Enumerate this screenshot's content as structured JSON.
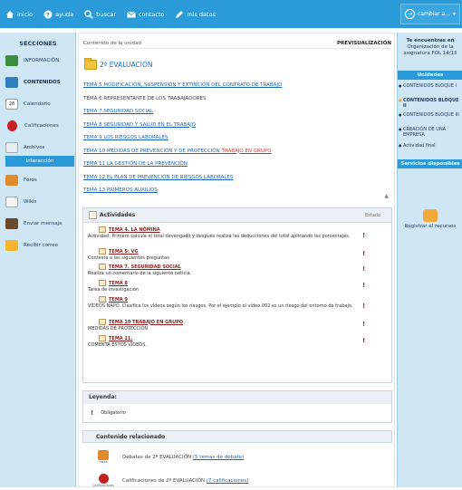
{
  "nav": {
    "items": [
      {
        "label": "inicio",
        "icon": "home-icon"
      },
      {
        "label": "ayuda",
        "icon": "help-icon"
      },
      {
        "label": "buscar",
        "icon": "search-icon"
      },
      {
        "label": "contacto",
        "icon": "mail-icon"
      },
      {
        "label": "mis datos",
        "icon": "pencil-icon"
      }
    ],
    "change": "cambiar a..."
  },
  "sidebar": {
    "title": "SECCIONES",
    "items": [
      {
        "label": "INFORMACIÓN",
        "icon": "info-icon"
      },
      {
        "label": "CONTENIDOS",
        "icon": "contents-icon"
      },
      {
        "label": "Calendario",
        "icon": "calendar-icon"
      },
      {
        "label": "Calificaciones",
        "icon": "grades-icon"
      },
      {
        "label": "Archivos",
        "icon": "files-icon"
      }
    ],
    "section": "Interacción",
    "items2": [
      {
        "label": "Foros",
        "icon": "forum-icon"
      },
      {
        "label": "Wikis",
        "icon": "wiki-icon"
      },
      {
        "label": "Enviar mensaje",
        "icon": "send-message-icon"
      },
      {
        "label": "Recibir correo",
        "icon": "receive-mail-icon"
      }
    ]
  },
  "main": {
    "breadcrumb": "Contenido de la unidad",
    "preview": "PREVISUALIZACIÓN",
    "evaluation": "2ª EVALUACIÓN",
    "topics": [
      {
        "text": "TEMA 5 MODIFICACIÓN, SUSPENSIÓN Y EXTINCIÓN DEL CONTRATO DE TRABAJO",
        "link": true
      },
      {
        "text": "TEMA 6 REPRESENTANTE DE LOS TRABAJADORES",
        "link": false
      },
      {
        "text": "TEMA 7 SEGURIDAD SOCIAL",
        "link": true
      },
      {
        "text": "TEMA 8 SEGURIDAD Y SALUD EN EL TRABAJO",
        "link": true
      },
      {
        "text": "TEMA 9 LOS RIESGOS LABORALES",
        "link": true
      },
      {
        "text": "TEMA 10 MEDIDAS DE PREVENCIÓN Y DE PROTECCIÓN",
        "link": true,
        "extra": "TRABAJO EN GRUPO"
      },
      {
        "text": "TEMA 11 LA GESTIÓN DE LA PREVENCIÓN",
        "link": true
      },
      {
        "text": "TEMA 12 EL PLAN DE PREVENCIÓN DE RIESGOS LABORALES",
        "link": true
      },
      {
        "text": "TEMA 13 PRIMEROS AUXILIOS",
        "link": true
      }
    ]
  },
  "activities": {
    "title": "Actividades",
    "state_header": "Estado",
    "items": [
      {
        "title": "TEMA 4. LA NÓMINA",
        "desc": "Actividad. Primero calcula el total devengado y después realiza las deducciones del total aplicando las porcentajes."
      },
      {
        "title": "TEMA 5: VG",
        "desc": "Contesta a las siguientes preguntas"
      },
      {
        "title": "TEMA 7. SEGURIDAD SOCIAL",
        "desc": "Realiza un comentario de la siguiente noticia."
      },
      {
        "title": "TEMA 8",
        "desc": "Tarea de investigación"
      },
      {
        "title": "TEMA 9",
        "desc": "VÍDEOS NAPO. Clasifica los vídeos según los riesgos. Por el ejemplo el vídeo 002 es un riesgo del entorno de trabajo."
      },
      {
        "title": "TEMA 10 TRABAJO EN GRUPO",
        "desc": "MEDIDAS DE PROTECCIÓN"
      },
      {
        "title": "TEMA 11.",
        "desc": "COMENTA ESTOS VÍDEOS."
      }
    ],
    "status_symbol": "!"
  },
  "legend": {
    "title": "Leyenda:",
    "symbol": "!",
    "label": "Obligatorio"
  },
  "related": {
    "title": "Contenido relacionado",
    "items": [
      {
        "text": "Debates de 2ª EVALUACIÓN",
        "link": "(5 temas de debate)",
        "icon": "forum-icon",
        "caption": "Foros"
      },
      {
        "text": "Calificaciones de 2ª EVALUACIÓN",
        "link": "(7 calificaciones)",
        "icon": "grades-icon",
        "caption": "Calificaciones"
      }
    ]
  },
  "rside": {
    "intro_lines": [
      "Te encuentras en",
      "Organización de la",
      "asignatura FOL 14/15"
    ],
    "units_title": "Unidades",
    "units": [
      {
        "label": "CONTENIDOS BLOQUE I",
        "highlight": false
      },
      {
        "label": "CONTENIDOS BLOQUE II",
        "highlight": true
      },
      {
        "label": "CONTENIDOS BLOQUE III",
        "highlight": false
      },
      {
        "label": "CREACIÓN DE UNA EMPRESA",
        "highlight": false
      },
      {
        "label": "Actividad final",
        "highlight": false
      }
    ],
    "services_title": "Servicios disponibles",
    "repo_label": "Registrar el recursos"
  },
  "colors": {
    "topbar": "#2a9ad8",
    "sidebar": "#cfe7f5",
    "link": "#1a66b5",
    "alert": "#d42020"
  }
}
